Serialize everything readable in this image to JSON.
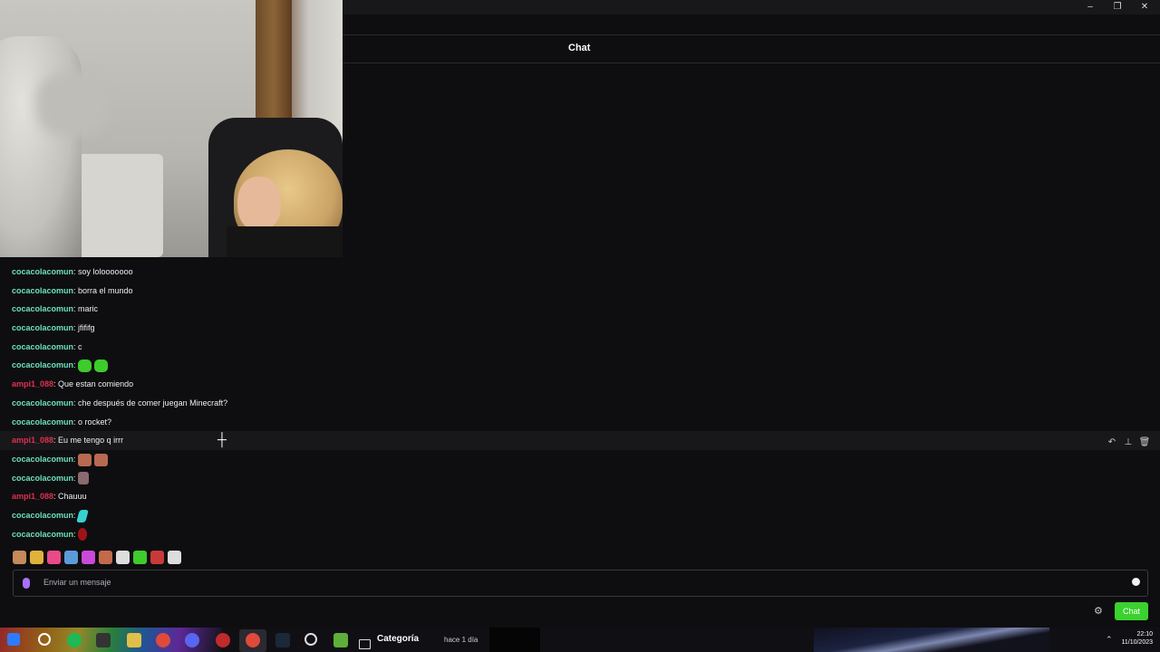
{
  "window": {
    "controls": [
      "–",
      "❐",
      "✕"
    ]
  },
  "chat_header": {
    "title": "Chat"
  },
  "messages": [
    {
      "user": "cocacolacomun",
      "text": ": soy lolooooooo",
      "color": "#6ee0b8",
      "emotes": []
    },
    {
      "user": "cocacolacomun",
      "text": ": borra el mundo",
      "color": "#6ee0b8",
      "emotes": []
    },
    {
      "user": "cocacolacomun",
      "text": ": maric",
      "color": "#6ee0b8",
      "emotes": []
    },
    {
      "user": "cocacolacomun",
      "text": ": jfififg",
      "color": "#6ee0b8",
      "emotes": []
    },
    {
      "user": "cocacolacomun",
      "text": ": c",
      "color": "#6ee0b8",
      "emotes": []
    },
    {
      "user": "cocacolacomun",
      "text": ":",
      "color": "#6ee0b8",
      "emotes": [
        "green-creeper-emote",
        "green-creeper-emote"
      ]
    },
    {
      "user": "ampi1_088",
      "text": ": Que estan comiendo",
      "color": "#e0304e",
      "emotes": []
    },
    {
      "user": "cocacolacomun",
      "text": ": che después de comer juegan Minecraft?",
      "color": "#6ee0b8",
      "emotes": []
    },
    {
      "user": "cocacolacomun",
      "text": ": o rocket?",
      "color": "#6ee0b8",
      "emotes": []
    },
    {
      "user": "ampi1_088",
      "text": ": Eu me tengo q irrr",
      "color": "#e0304e",
      "emotes": [],
      "hovered": true
    },
    {
      "user": "cocacolacomun",
      "text": ":",
      "color": "#6ee0b8",
      "emotes": [
        "face-emote",
        "face-emote"
      ]
    },
    {
      "user": "cocacolacomun",
      "text": ":",
      "color": "#6ee0b8",
      "emotes": [
        "small-figure-emote"
      ]
    },
    {
      "user": "ampi1_088",
      "text": ": Chauuu",
      "color": "#e0304e",
      "emotes": []
    },
    {
      "user": "cocacolacomun",
      "text": ":",
      "color": "#6ee0b8",
      "emotes": [
        "cyan-figure-emote"
      ]
    },
    {
      "user": "cocacolacomun",
      "text": ":",
      "color": "#6ee0b8",
      "emotes": [
        "red-figure-emote"
      ]
    }
  ],
  "hover_tools": [
    "↶",
    "⊥",
    "🗑"
  ],
  "emote_picker_row": [
    "#c48a5a",
    "#e0b23a",
    "#e84a8a",
    "#5a9bd8",
    "#c84ad8",
    "#c46a4a",
    "#ddd",
    "#3ecb2c",
    "#c83a3a",
    "#ddd"
  ],
  "input": {
    "placeholder": "Enviar un mensaje"
  },
  "send_button": {
    "label": "Chat"
  },
  "taskbar": {
    "category_label": "Categoría",
    "time_ago": "hace 1 día",
    "clock_time": "22:10",
    "clock_date": "11/10/2023"
  },
  "colors": {
    "accent_green": "#3bd12f",
    "user_green": "#6ee0b8",
    "user_red": "#e0304e",
    "background": "#0e0e10"
  }
}
